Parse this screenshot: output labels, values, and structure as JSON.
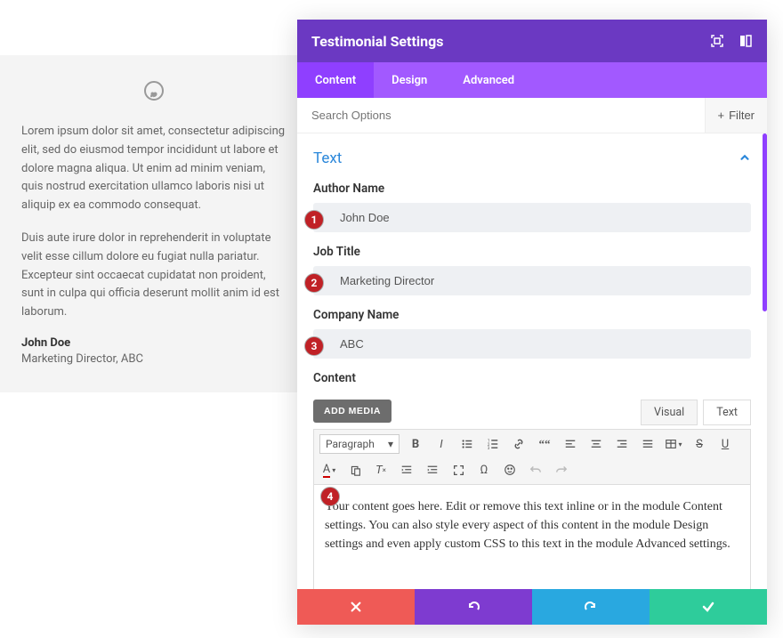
{
  "testimonial": {
    "para1": "Lorem ipsum dolor sit amet, consectetur adipiscing elit, sed do eiusmod tempor incididunt ut labore et dolore magna aliqua. Ut enim ad minim veniam, quis nostrud exercitation ullamco laboris nisi ut aliquip ex ea commodo consequat.",
    "para2": "Duis aute irure dolor in reprehenderit in voluptate velit esse cillum dolore eu fugiat nulla pariatur. Excepteur sint occaecat cupidatat non proident, sunt in culpa qui officia deserunt mollit anim id est laborum.",
    "author": "John Doe",
    "role": "Marketing Director, ABC"
  },
  "panel": {
    "title": "Testimonial Settings",
    "tabs": {
      "content": "Content",
      "design": "Design",
      "advanced": "Advanced"
    },
    "search_placeholder": "Search Options",
    "filter_label": "Filter",
    "section_text": "Text",
    "fields": {
      "author_label": "Author Name",
      "author_value": "John Doe",
      "job_label": "Job Title",
      "job_value": "Marketing Director",
      "company_label": "Company Name",
      "company_value": "ABC",
      "content_label": "Content",
      "add_media": "ADD MEDIA",
      "mode_visual": "Visual",
      "mode_text": "Text",
      "format_dropdown": "Paragraph",
      "content_body": "Your content goes here. Edit or remove this text inline or in the module Content settings. You can also style every aspect of this content in the module Design settings and even apply custom CSS to this text in the module Advanced settings."
    }
  },
  "annotations": {
    "b1": "1",
    "b2": "2",
    "b3": "3",
    "b4": "4"
  }
}
